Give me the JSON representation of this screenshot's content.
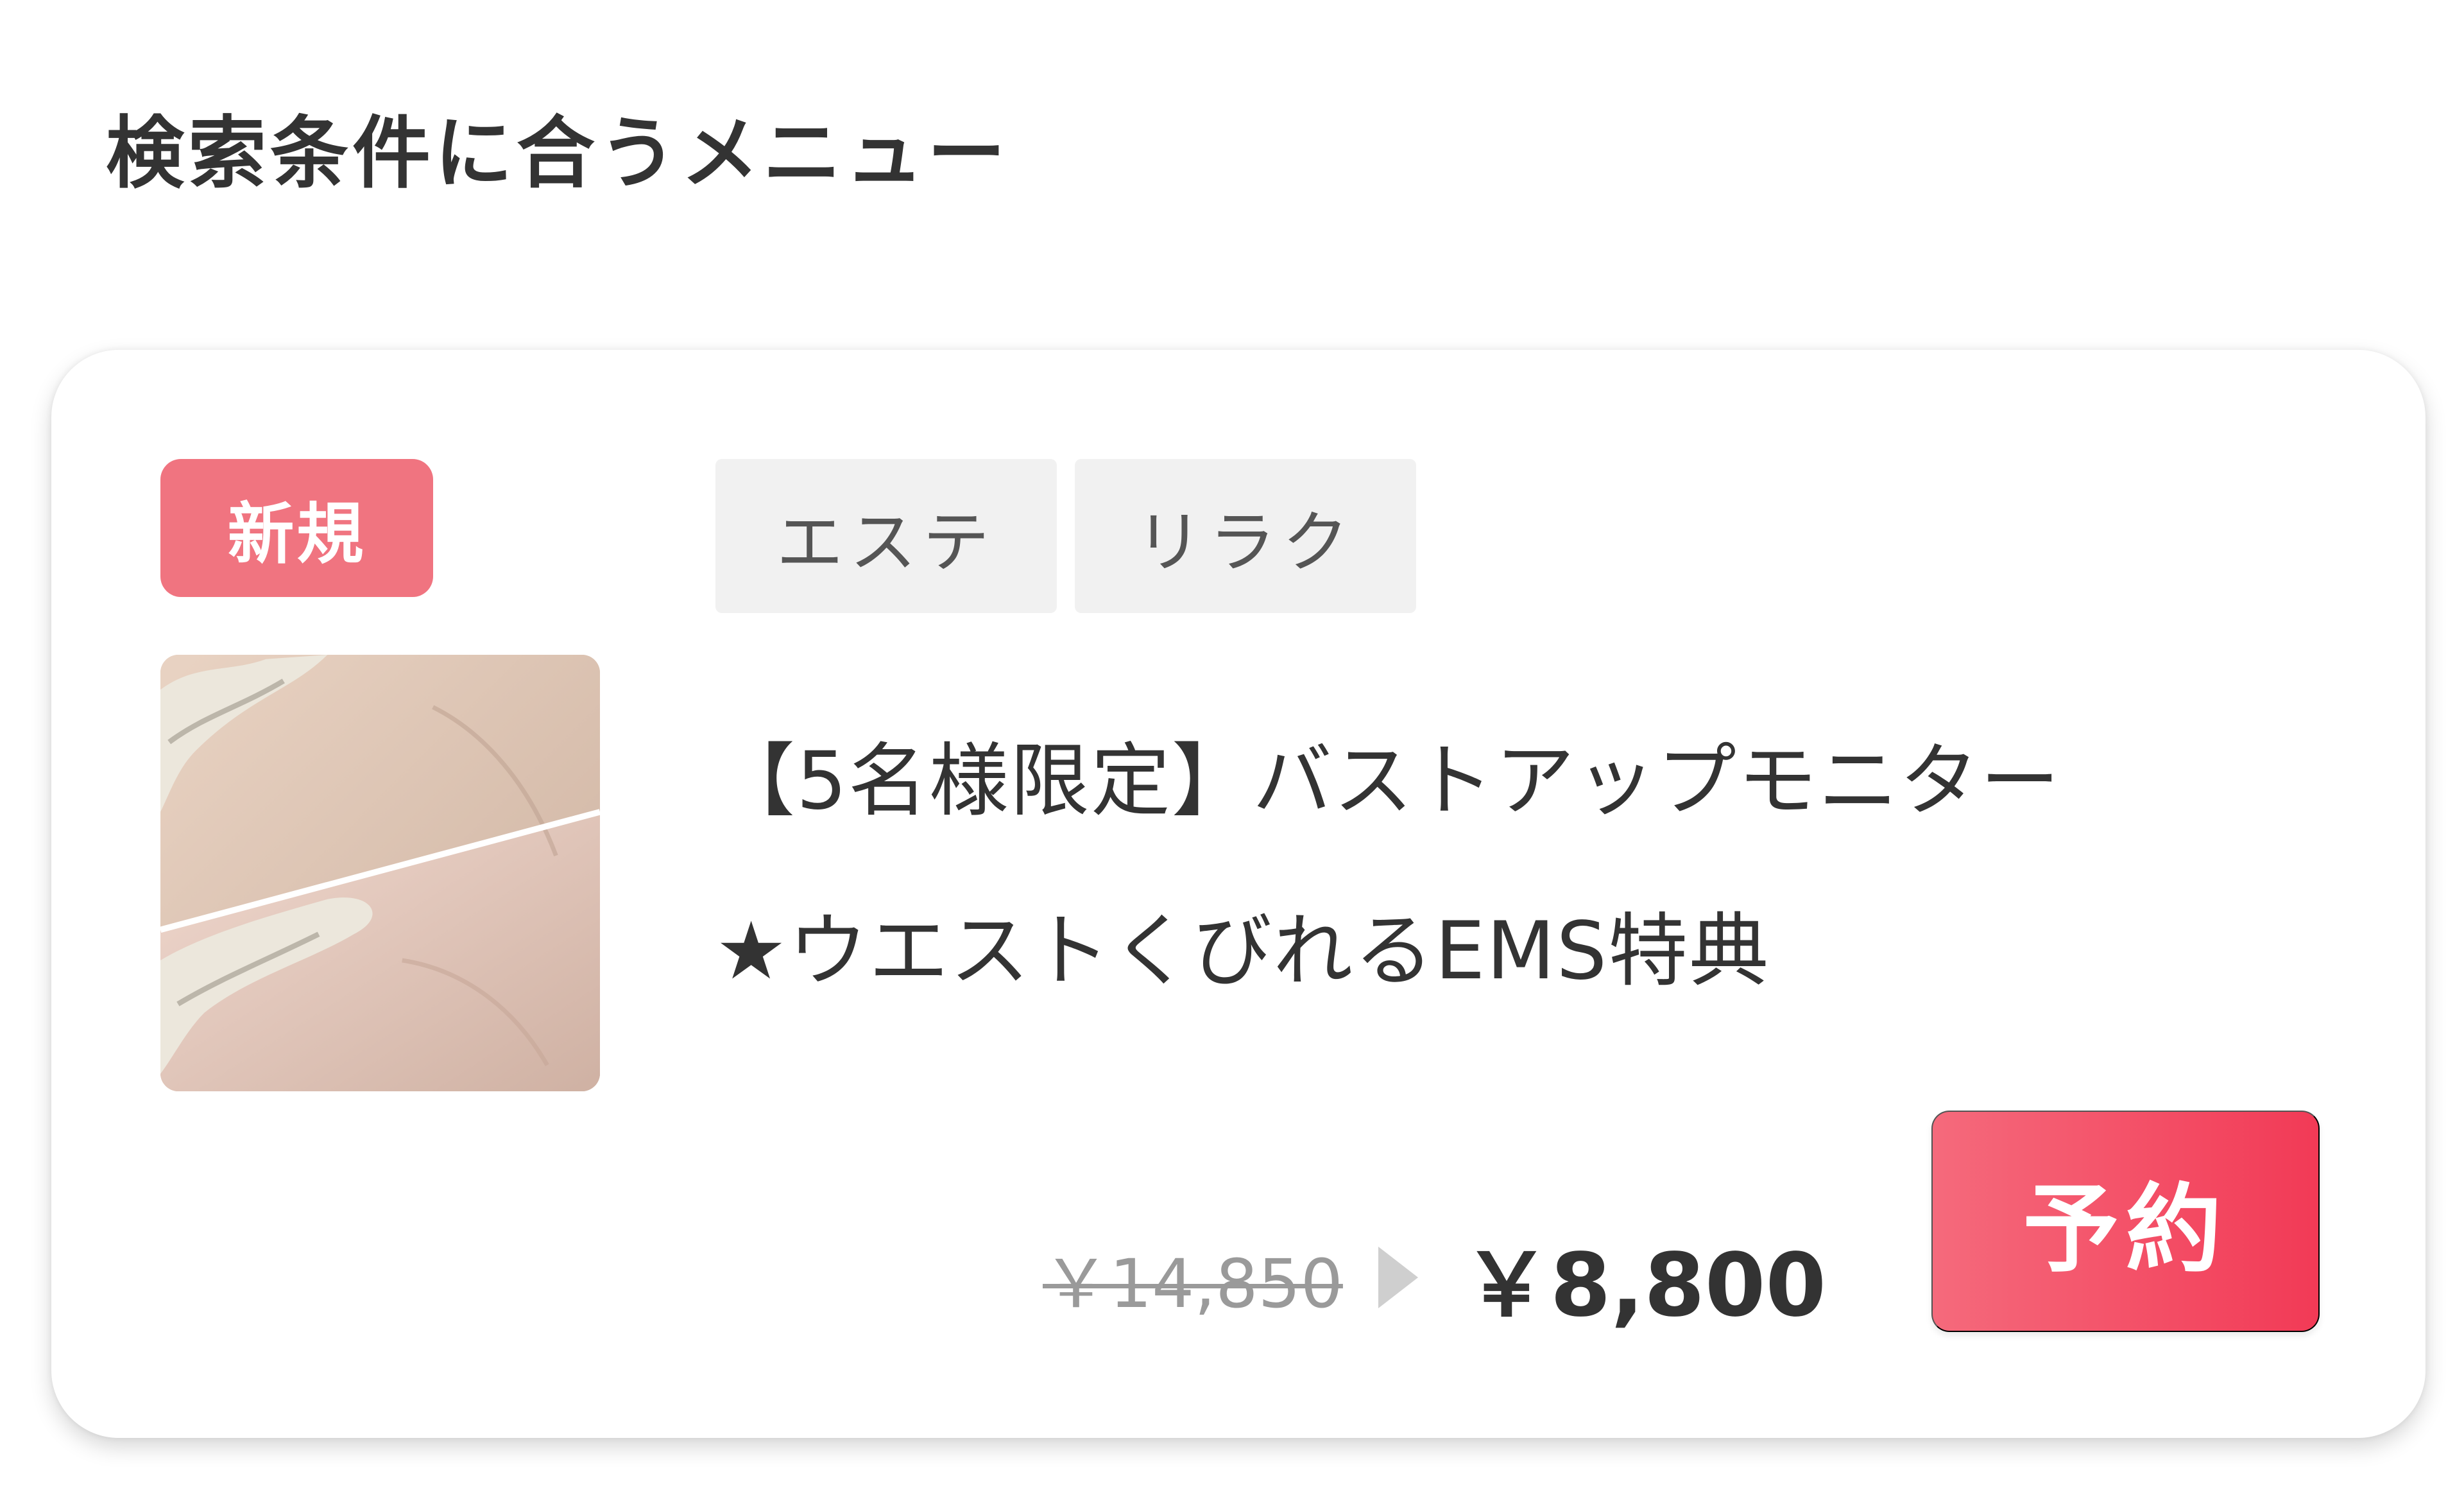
{
  "section": {
    "title": "検索条件に合うメニュー"
  },
  "menu_card": {
    "badge": "新規",
    "thumbnail": {
      "icon": "product-photo-icon"
    },
    "tags": [
      {
        "label": "エステ"
      },
      {
        "label": "リラク"
      }
    ],
    "title_line1": "【5名様限定】バストアップモニター",
    "title_line2": "★ウエストくびれるEMS特典",
    "price": {
      "original": "￥14,850",
      "current": "￥8,800"
    },
    "reserve_label": "予約"
  },
  "colors": {
    "badge_new": "#f07480",
    "reserve_button_start": "#f56a7c",
    "reserve_button_end": "#f23a56",
    "tag_background": "#f1f1f1",
    "text_primary": "#333333",
    "text_muted": "#9a9a9a"
  }
}
